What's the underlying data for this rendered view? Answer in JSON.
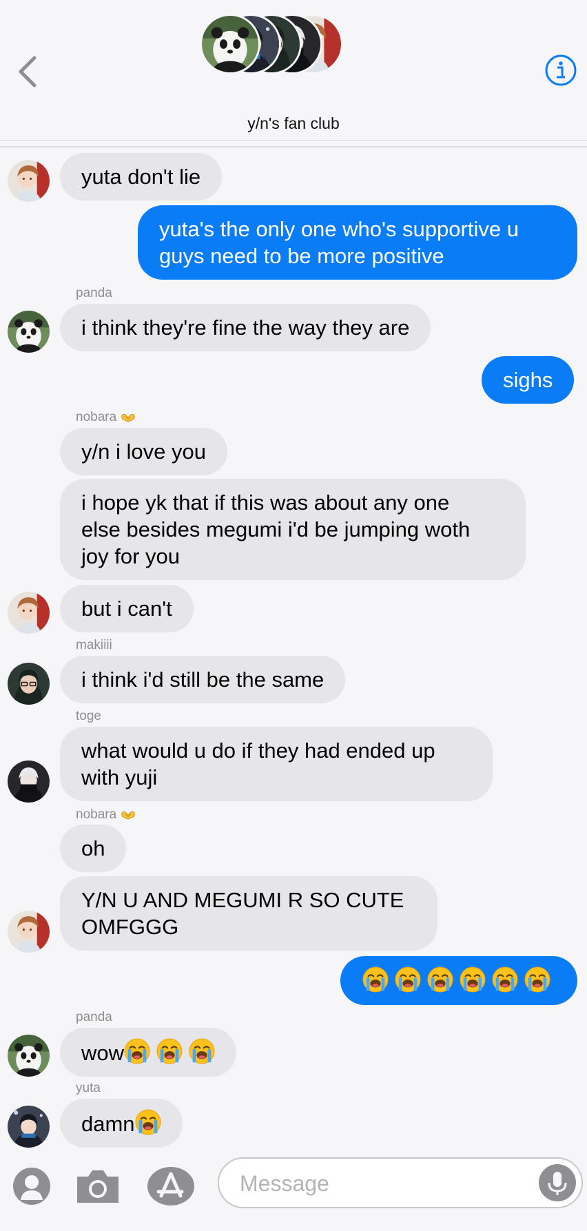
{
  "header": {
    "group_name": "y/n's fan club"
  },
  "composer": {
    "placeholder": "Message"
  },
  "messages": [
    {
      "text": "yuta don't lie"
    },
    {
      "line1": "yuta's the only one who's supportive u",
      "line2": "guys need to be more positive"
    },
    {
      "sender": "panda",
      "text": "i think they're fine the way they are"
    },
    {
      "text": "sighs"
    },
    {
      "sender": "nobara",
      "text": "y/n i love you"
    },
    {
      "line1": "i hope yk that if this was about any one",
      "line2": "else besides megumi i'd be jumping woth",
      "line3": "joy for you"
    },
    {
      "text": "but i can't"
    },
    {
      "sender": "makiiii",
      "text": "i think i'd still be the same"
    },
    {
      "sender": "toge",
      "line1": "what would u do if they had ended up",
      "line2": "with yuji"
    },
    {
      "sender": "nobara",
      "text": "oh"
    },
    {
      "line1": "Y/N U AND MEGUMI R SO CUTE",
      "line2": "OMFGGG"
    },
    {
      "emoji_count": 6,
      "emoji": "loudly-crying-face"
    },
    {
      "sender": "panda",
      "text": "wow",
      "emoji_count": 3
    },
    {
      "sender": "yuta",
      "text": "damn",
      "emoji_count": 1
    }
  ],
  "colors": {
    "outgoing_bubble": "#0a7cf5",
    "incoming_bubble": "#e6e5ea",
    "accent": "#0a7cf5"
  }
}
